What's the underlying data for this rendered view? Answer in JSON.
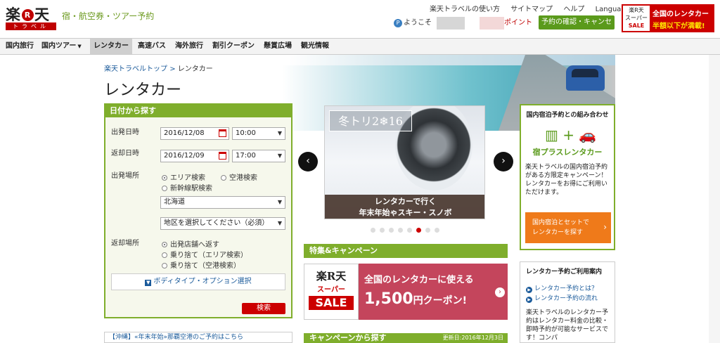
{
  "header": {
    "logo_kanji_left": "楽",
    "logo_r": "R",
    "logo_kanji_right": "天",
    "logo_travel": "トラベル",
    "tagline": "宿・航空券・ツアー予約",
    "top_links": [
      "楽天トラベルの使い方",
      "サイトマップ",
      "ヘルプ",
      "Languages ▾"
    ],
    "welcome_p": "P",
    "welcome": "ようこそ",
    "point": "ポイント",
    "confirm_button": "予約の確認・キャンセル",
    "sale_banner": {
      "logo_line1": "楽R天",
      "logo_line2": "スーパー",
      "logo_line3": "SALE",
      "line1": "全国のレンタカー",
      "line2": "半額以下が満載!"
    }
  },
  "nav": {
    "items": [
      "国内旅行",
      "国内ツアー",
      "レンタカー",
      "高速バス",
      "海外旅行",
      "割引クーポン",
      "懸賞広場",
      "観光情報"
    ]
  },
  "breadcrumb": {
    "home": "楽天トラベルトップ",
    "sep": ">",
    "current": "レンタカー"
  },
  "page_title": "レンタカー",
  "form": {
    "header": "日付から探す",
    "depart_label": "出発日時",
    "depart_date": "2016/12/08",
    "depart_time": "10:00",
    "return_label": "返却日時",
    "return_date": "2016/12/09",
    "return_time": "17:00",
    "place_label": "出発場所",
    "place_options": [
      "エリア検索",
      "空港検索",
      "新幹線駅検索"
    ],
    "prefecture": "北海道",
    "area_placeholder": "地区を選択してください（必須）",
    "return_place_label": "返却場所",
    "return_options": [
      "出発店舗へ返す",
      "乗り捨て（エリア検索）",
      "乗り捨て（空港検索）"
    ],
    "body_type_button": "ボディタイプ・オプション選択",
    "search_button": "検索"
  },
  "notice": "【沖縄】«年末年始»那覇空港のご予約はこちら",
  "slider": {
    "winter_text": "冬トリ2❄16",
    "caption_line1": "レンタカーで行く",
    "caption_line2": "年末年始ゃスキー・スノボ",
    "dot_count": 8,
    "active_dot": 6
  },
  "features": {
    "header": "特集&キャンペーン",
    "coupon_logo1": "楽R天",
    "coupon_logo2": "スーパー",
    "coupon_logo3": "SALE",
    "coupon_line1": "全国のレンタカーに使える",
    "coupon_amount": "1,500",
    "coupon_suffix": "円クーポン!"
  },
  "campaign": {
    "header": "キャンペーンから探す",
    "date": "更新日:2016年12月3日"
  },
  "side_package": {
    "header": "国内宿泊予約との組み合わせ",
    "name": "宿プラスレンタカー",
    "description": "楽天トラベルの国内宿泊予約がある方限定キャンペーン！レンタカーをお得にご利用いただけます。",
    "button_line1": "国内宿泊とセットで",
    "button_line2": "レンタカーを探す"
  },
  "side_guide": {
    "header": "レンタカー予約ご利用案内",
    "links": [
      "レンタカー予約とは？",
      "レンタカー予約の流れ"
    ],
    "description": "楽天トラベルのレンタカー予約はレンタカー料金の比較・即時予約が可能なサービスです！コンパ"
  },
  "colors": {
    "brand_green": "#7fae2c",
    "brand_red": "#bf0000",
    "orange": "#ef7a1a",
    "coupon_pink": "#c4455c"
  }
}
